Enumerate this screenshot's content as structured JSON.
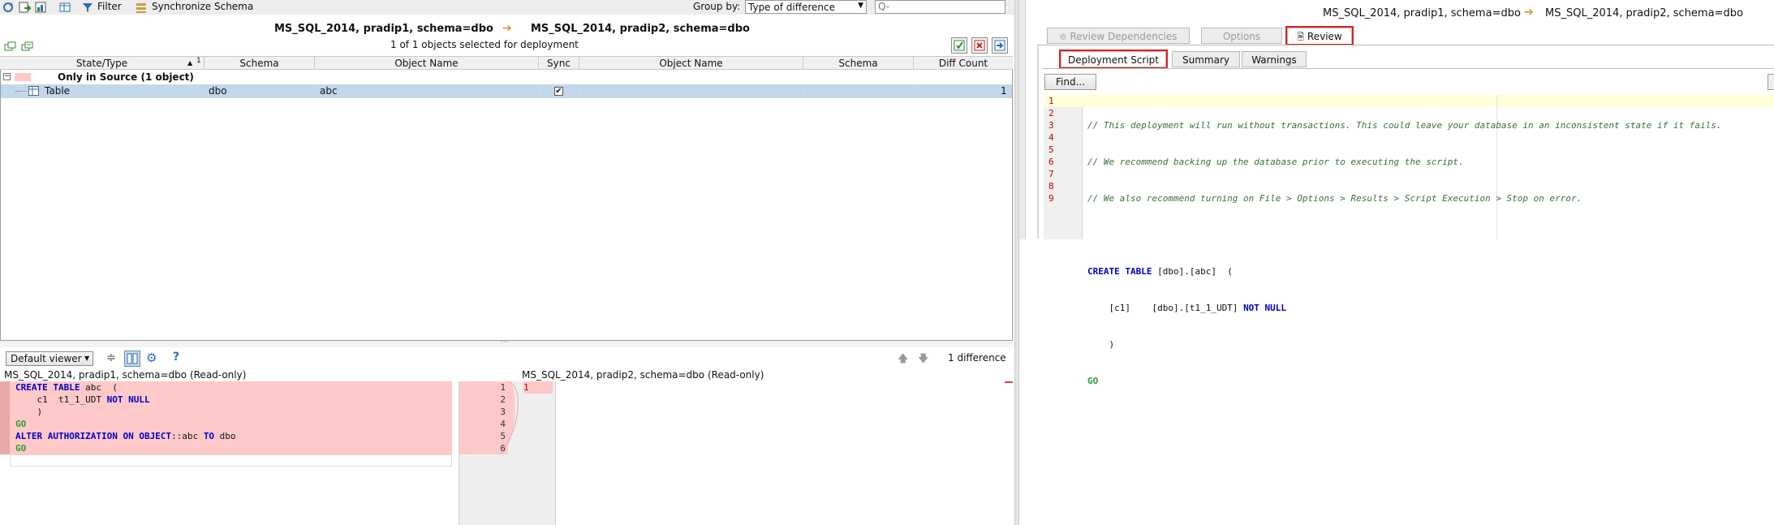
{
  "toolbar": {
    "filter_label": "Filter",
    "sync_label": "Synchronize Schema",
    "groupby_label": "Group by:",
    "groupby_value": "Type of difference",
    "search_placeholder": "Q-"
  },
  "comparison": {
    "source": "MS_SQL_2014, pradip1,  schema=dbo",
    "target": "MS_SQL_2014, pradip2,  schema=dbo",
    "selected_text": "1 of 1 objects selected for deployment"
  },
  "grid": {
    "headers": {
      "state_type": "State/Type",
      "sort_indicator": "1",
      "schema": "Schema",
      "object_name": "Object Name",
      "sync": "Sync",
      "object_name2": "Object Name",
      "schema2": "Schema",
      "diff_count": "Diff Count"
    },
    "group_label": "Only in Source (1 object)",
    "rows": [
      {
        "type": "Table",
        "schema": "dbo",
        "object_name": "abc",
        "diff_count": "1"
      }
    ]
  },
  "diff_viewer": {
    "viewer_label": "Default viewer",
    "difference_count": "1 difference",
    "left_title": "MS_SQL_2014, pradip1, schema=dbo (Read-only)",
    "right_title": "MS_SQL_2014, pradip2, schema=dbo (Read-only)",
    "left_lines": [
      {
        "kw": "CREATE TABLE",
        "rest": " abc  ("
      },
      {
        "kw": "",
        "rest": "    c1  t1_1_UDT ",
        "kw2": "NOT NULL"
      },
      {
        "kw": "",
        "rest": "    )"
      },
      {
        "go": "GO"
      },
      {
        "kw": "ALTER AUTHORIZATION ON OBJECT",
        "rest": "::abc ",
        "kw2": "TO",
        "rest2": " dbo"
      },
      {
        "go": "GO"
      }
    ],
    "left_line_numbers": [
      "1",
      "2",
      "3",
      "4",
      "5",
      "6"
    ],
    "right_line_numbers": [
      "1"
    ]
  },
  "review": {
    "header_source": "MS_SQL_2014, pradip1,  schema=dbo",
    "header_target": "MS_SQL_2014, pradip2,  schema=dbo",
    "top_tabs": [
      "Review Dependencies",
      "Options",
      "Review"
    ],
    "sub_tabs": [
      "Deployment Script",
      "Summary",
      "Warnings"
    ],
    "find_label": "Find...",
    "script_line_numbers": [
      "1",
      "2",
      "3",
      "4",
      "5",
      "6",
      "7",
      "8",
      "9"
    ],
    "script": {
      "c1": "// This deployment will run without transactions. This could leave your database in an inconsistent state if it fails.",
      "c2": "// We recommend backing up the database prior to executing the script.",
      "c3": "// We also recommend turning on File > Options > Results > Script Execution > Stop on error.",
      "l5_kw": "CREATE TABLE",
      "l5_rest": " [dbo].[abc]  (",
      "l6_rest": "    [c1]    [dbo].[t1_1_UDT] ",
      "l6_kw": "NOT NULL",
      "l7": "    )",
      "l8": "GO"
    }
  },
  "colors": {
    "diff_pink": "#ffc9c9",
    "selected_row": "#c4d6ea",
    "keyword": "#0000c8",
    "go": "#2e9a2e",
    "line_number": "#c00000",
    "highlight_outline": "#e02020"
  }
}
